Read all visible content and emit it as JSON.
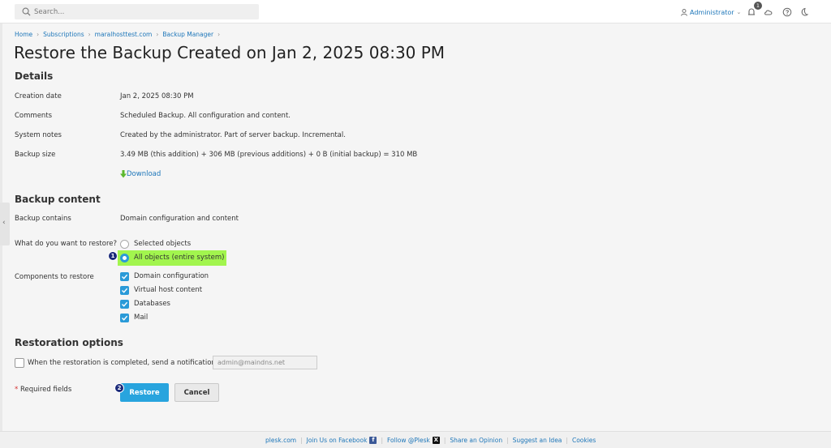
{
  "search": {
    "placeholder": "Search..."
  },
  "header": {
    "user": "Administrator",
    "notification_count": "1"
  },
  "breadcrumb": [
    "Home",
    "Subscriptions",
    "maralhosttest.com",
    "Backup Manager"
  ],
  "page_title": "Restore the Backup Created on Jan 2, 2025 08:30 PM",
  "details": {
    "title": "Details",
    "rows": [
      {
        "label": "Creation date",
        "value": "Jan 2, 2025 08:30 PM"
      },
      {
        "label": "Comments",
        "value": "Scheduled Backup. All configuration and content."
      },
      {
        "label": "System notes",
        "value": "Created by the administrator. Part of server backup. Incremental."
      },
      {
        "label": "Backup size",
        "value": "3.49 MB (this addition) + 306 MB (previous additions) + 0 B (initial backup) = 310 MB"
      }
    ],
    "download_label": "Download"
  },
  "backup_content": {
    "title": "Backup content",
    "contains_label": "Backup contains",
    "contains_value": "Domain configuration and content",
    "restore_question": "What do you want to restore?",
    "options": [
      {
        "label": "Selected objects",
        "selected": false
      },
      {
        "label": "All objects (entire system)",
        "selected": true
      }
    ],
    "components_label": "Components to restore",
    "components": [
      {
        "label": "Domain configuration",
        "checked": true
      },
      {
        "label": "Virtual host content",
        "checked": true
      },
      {
        "label": "Databases",
        "checked": true
      },
      {
        "label": "Mail",
        "checked": true
      }
    ]
  },
  "restoration_options": {
    "title": "Restoration options",
    "notify_label": "When the restoration is completed, send a notification to",
    "notify_checked": false,
    "email_placeholder": "admin@maindns.net"
  },
  "form": {
    "required_star": "*",
    "required_label": "Required fields",
    "restore_label": "Restore",
    "cancel_label": "Cancel"
  },
  "markers": [
    "1",
    "2"
  ],
  "footer": {
    "links": [
      "plesk.com",
      "Join Us on Facebook",
      "Follow @Plesk",
      "Share an Opinion",
      "Suggest an Idea",
      "Cookies"
    ]
  },
  "colors": {
    "accent": "#28a4de",
    "link": "#1d76b9",
    "highlight": "#a2f54e",
    "marker": "#1b2a7a",
    "download_arrow": "#5cb82e",
    "required_star": "#d42f2f"
  }
}
